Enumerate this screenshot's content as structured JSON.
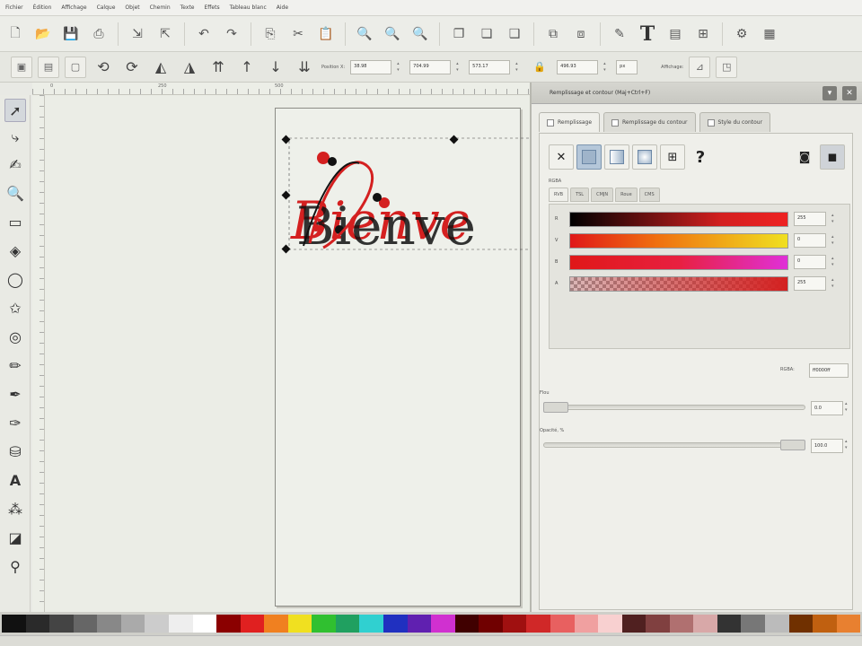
{
  "menu": [
    "Fichier",
    "Édition",
    "Affichage",
    "Calque",
    "Objet",
    "Chemin",
    "Texte",
    "Effets",
    "Tableau blanc",
    "Aide"
  ],
  "toolbar": {
    "position_x_label": "Position X:",
    "x_value": "38.98",
    "y_value": "704.99",
    "w_value": "573.17",
    "h_value": "496.93",
    "unit": "px",
    "affichage_label": "Affichage:"
  },
  "ruler": {
    "marks": [
      "0",
      "250",
      "500"
    ]
  },
  "canvas": {
    "text": "Bienve"
  },
  "dialog": {
    "title": "Remplissage et contour (Maj+Ctrl+F)",
    "tabs": [
      "Remplissage",
      "Remplissage du contour",
      "Style du contour"
    ],
    "mode_label": "RGBA",
    "mode_tabs": [
      "RVB",
      "TSL",
      "CMJN",
      "Roue",
      "CMS"
    ],
    "channels": [
      {
        "label": "R",
        "value": "255"
      },
      {
        "label": "V",
        "value": "0"
      },
      {
        "label": "B",
        "value": "0"
      },
      {
        "label": "A",
        "value": "255"
      }
    ],
    "rgba_label": "RGBA:",
    "rgba_value": "ff0000ff",
    "blur_label": "Flou",
    "blur_value": "0.0",
    "opacity_label": "Opacité, %",
    "opacity_value": "100.0"
  },
  "colors": {
    "accent": "#d42020",
    "ink": "#111111"
  }
}
